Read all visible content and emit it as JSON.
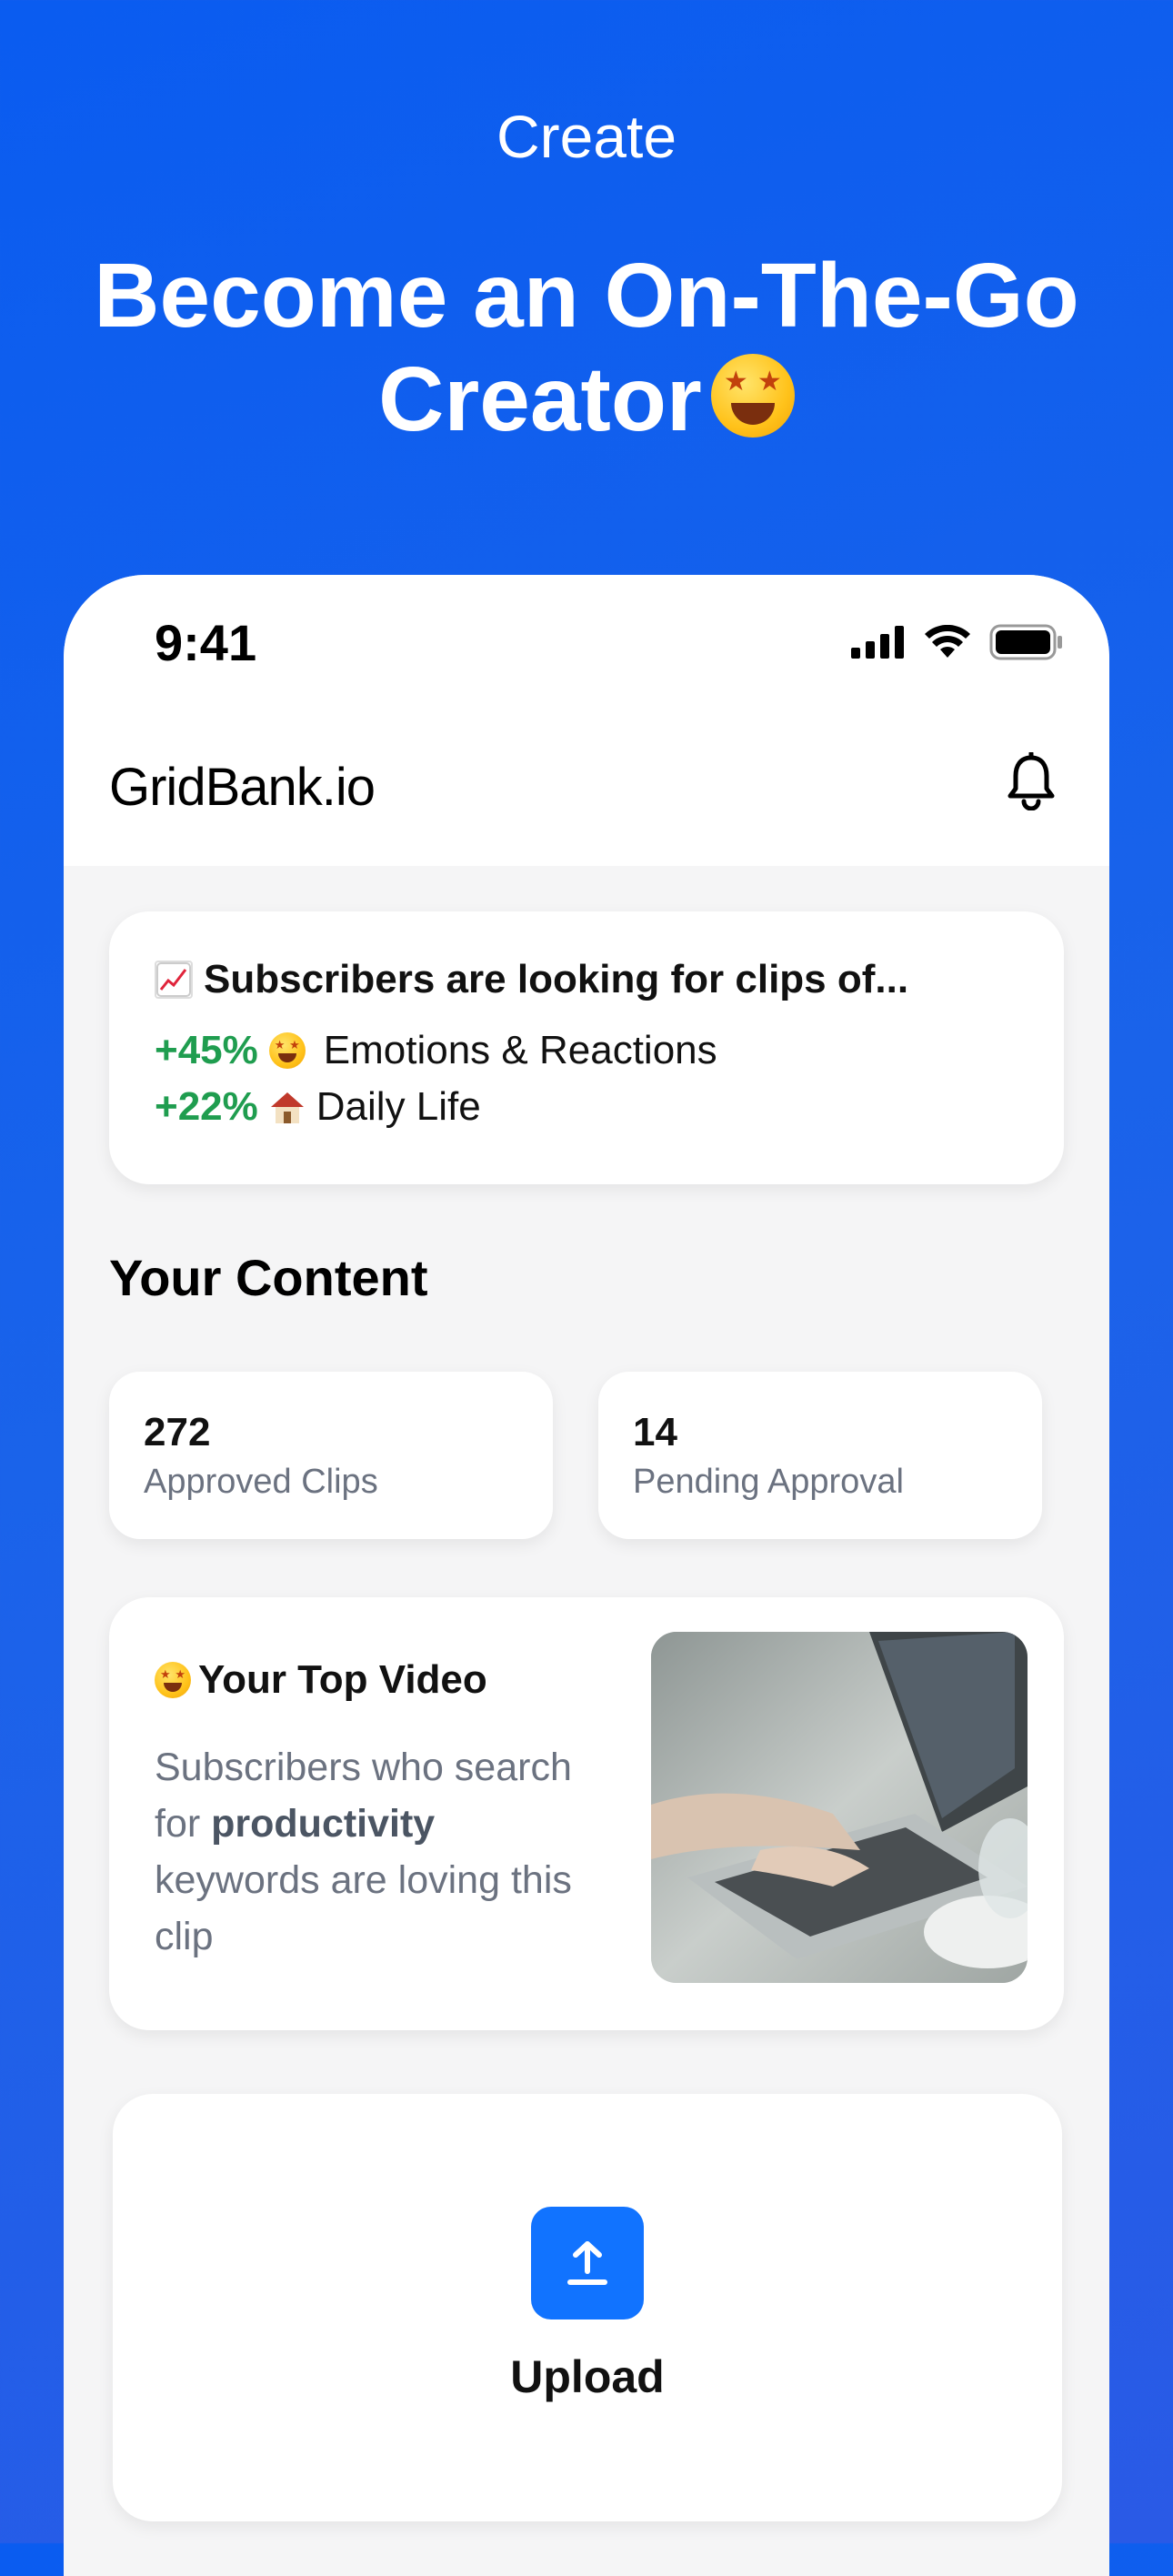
{
  "hero": {
    "eyebrow": "Create",
    "title": "Become an On-The-Go Creator"
  },
  "status_bar": {
    "time": "9:41"
  },
  "app_bar": {
    "brand": "GridBank.io"
  },
  "trends": {
    "title": "Subscribers are looking for clips of...",
    "rows": [
      {
        "pct": "+45%",
        "label": "Emotions & Reactions"
      },
      {
        "pct": "+22%",
        "label": "Daily Life"
      }
    ]
  },
  "content": {
    "section_title": "Your Content",
    "stats": [
      {
        "value": "272",
        "label": "Approved Clips"
      },
      {
        "value": "14",
        "label": "Pending Approval"
      }
    ]
  },
  "top_video": {
    "title": "Your Top Video",
    "desc_before": "Subscribers who search for ",
    "desc_bold": "productivity",
    "desc_after": " keywords are loving this clip"
  },
  "upload": {
    "label": "Upload"
  },
  "colors": {
    "background": "#0a5cf0",
    "accent": "#1173ff",
    "positive": "#1f9d4f"
  }
}
